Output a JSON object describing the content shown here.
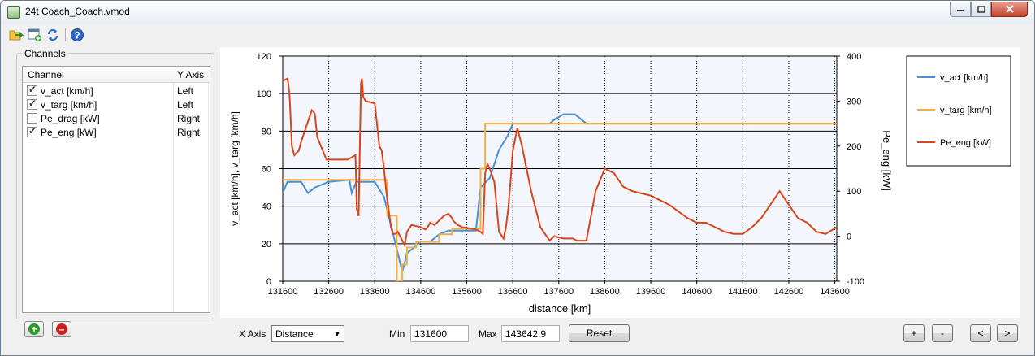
{
  "window": {
    "title": "24t Coach_Coach.vmod",
    "controls": [
      "minimize",
      "maximize",
      "close"
    ]
  },
  "toolbar": {
    "icons": [
      "open-file-icon",
      "add-file-icon",
      "refresh-icon",
      "help-icon"
    ]
  },
  "channels": {
    "group_label": "Channels",
    "headers": {
      "channel": "Channel",
      "y_axis": "Y Axis"
    },
    "rows": [
      {
        "name": "v_act [km/h]",
        "axis": "Left",
        "checked": true
      },
      {
        "name": "v_targ [km/h]",
        "axis": "Left",
        "checked": true
      },
      {
        "name": "Pe_drag [kW]",
        "axis": "Right",
        "checked": false
      },
      {
        "name": "Pe_eng [kW]",
        "axis": "Right",
        "checked": true
      }
    ],
    "add_icon": "plus-icon",
    "remove_icon": "minus-icon"
  },
  "bottom": {
    "x_axis_label": "X Axis",
    "x_axis_value": "Distance",
    "min_label": "Min",
    "min_value": "131600",
    "max_label": "Max",
    "max_value": "143642.9",
    "reset_label": "Reset",
    "zoom_in_label": "+",
    "zoom_out_label": "-",
    "prev_label": "<",
    "next_label": ">"
  },
  "colors": {
    "v_act": "#4a8fd8",
    "v_targ": "#f0b040",
    "Pe_eng": "#d9451c",
    "plot_bg": "#f4f6fd"
  },
  "chart_data": {
    "type": "line",
    "xlabel": "distance [km]",
    "ylabel_left": "v_act [km/h], v_targ [km/h]",
    "ylabel_right": "Pe_eng [kW]",
    "xlim": [
      131600,
      143642.9
    ],
    "ylim_left": [
      0,
      120
    ],
    "ylim_right": [
      -100,
      400
    ],
    "x_ticks": [
      131600,
      132600,
      133600,
      134600,
      135600,
      136600,
      137600,
      138600,
      139600,
      140600,
      141600,
      142600,
      143600
    ],
    "y_ticks_left": [
      0,
      20,
      40,
      60,
      80,
      100,
      120
    ],
    "y_ticks_right": [
      -100,
      0,
      100,
      200,
      300,
      400
    ],
    "legend_position": "right",
    "series": [
      {
        "name": "v_act [km/h]",
        "axis": "left",
        "x": [
          131600,
          131700,
          132000,
          132150,
          132300,
          132600,
          133050,
          133100,
          133200,
          133600,
          133800,
          133950,
          134100,
          134200,
          134300,
          134600,
          134800,
          135000,
          135200,
          135500,
          135800,
          135900,
          136100,
          136300,
          136500,
          136600,
          137400,
          137500,
          137700,
          137950,
          138050,
          138200,
          143642.9
        ],
        "y": [
          47,
          53,
          53,
          47,
          50,
          53,
          54,
          47,
          53,
          53,
          45,
          30,
          15,
          5,
          15,
          21,
          21,
          25,
          27,
          27,
          27,
          50,
          55,
          70,
          78,
          84,
          84,
          86,
          89,
          89,
          87,
          84,
          84
        ]
      },
      {
        "name": "v_targ [km/h]",
        "axis": "left",
        "x": [
          131600,
          133870,
          133870,
          134080,
          134080,
          134200,
          134200,
          134300,
          134300,
          134500,
          134500,
          135000,
          135000,
          135280,
          135280,
          135900,
          135900,
          136000,
          136000,
          143642.9
        ],
        "y": [
          54,
          54,
          35,
          35,
          0,
          0,
          9,
          9,
          18,
          18,
          21,
          21,
          25,
          25,
          28,
          28,
          60,
          60,
          84,
          84
        ]
      },
      {
        "name": "Pe_eng [kW]",
        "axis": "right",
        "x": [
          131600,
          131700,
          131720,
          131750,
          131800,
          131850,
          131950,
          132000,
          132100,
          132200,
          132230,
          132280,
          132300,
          132350,
          132550,
          133000,
          133100,
          133180,
          133210,
          133250,
          133300,
          133320,
          133350,
          133400,
          133600,
          133700,
          133750,
          133800,
          133850,
          133900,
          133950,
          134000,
          134050,
          134100,
          134150,
          134200,
          134250,
          134300,
          134400,
          134600,
          134700,
          134750,
          134800,
          134900,
          135000,
          135100,
          135200,
          135280,
          135300,
          135400,
          135500,
          135800,
          135900,
          135950,
          136000,
          136050,
          136100,
          136200,
          136300,
          136400,
          136450,
          136500,
          136550,
          136600,
          136700,
          136800,
          136900,
          137000,
          137100,
          137200,
          137400,
          137500,
          137700,
          137900,
          138000,
          138200,
          138400,
          138600,
          138800,
          139000,
          139200,
          139600,
          139800,
          140000,
          140400,
          140600,
          140800,
          141000,
          141200,
          141400,
          141600,
          141800,
          142000,
          142400,
          142600,
          142800,
          143000,
          143200,
          143400,
          143642.9
        ],
        "y": [
          345,
          350,
          340,
          310,
          200,
          180,
          190,
          210,
          240,
          270,
          280,
          275,
          270,
          220,
          170,
          170,
          175,
          180,
          60,
          45,
          340,
          350,
          310,
          300,
          295,
          200,
          190,
          150,
          100,
          60,
          20,
          5,
          5,
          10,
          0,
          -10,
          -20,
          10,
          25,
          20,
          15,
          20,
          30,
          25,
          35,
          45,
          50,
          40,
          35,
          25,
          20,
          15,
          10,
          5,
          140,
          160,
          150,
          120,
          10,
          -5,
          20,
          60,
          120,
          190,
          240,
          200,
          150,
          100,
          60,
          20,
          -10,
          0,
          -5,
          -5,
          -10,
          -10,
          100,
          150,
          140,
          110,
          100,
          90,
          80,
          70,
          40,
          30,
          30,
          20,
          10,
          5,
          5,
          20,
          40,
          100,
          70,
          40,
          30,
          10,
          5,
          20
        ]
      }
    ]
  }
}
